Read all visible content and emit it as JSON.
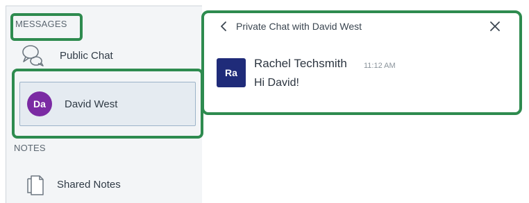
{
  "sidebar": {
    "messages_label": "MESSAGES",
    "public_chat_label": "Public Chat",
    "user": {
      "avatar_initials": "Da",
      "name": "David West",
      "avatar_color": "#7b2aa3"
    },
    "notes_label": "NOTES",
    "shared_notes_label": "Shared Notes"
  },
  "chat": {
    "title": "Private Chat with David West",
    "message": {
      "avatar_initials": "Ra",
      "avatar_color": "#1f2b79",
      "sender": "Rachel Techsmith",
      "time": "11:12 AM",
      "text": "Hi David!"
    }
  },
  "highlight_color": "#2e8b4f",
  "icons": [
    "chat-bubbles-icon",
    "document-icon",
    "chevron-left-icon",
    "close-icon"
  ]
}
